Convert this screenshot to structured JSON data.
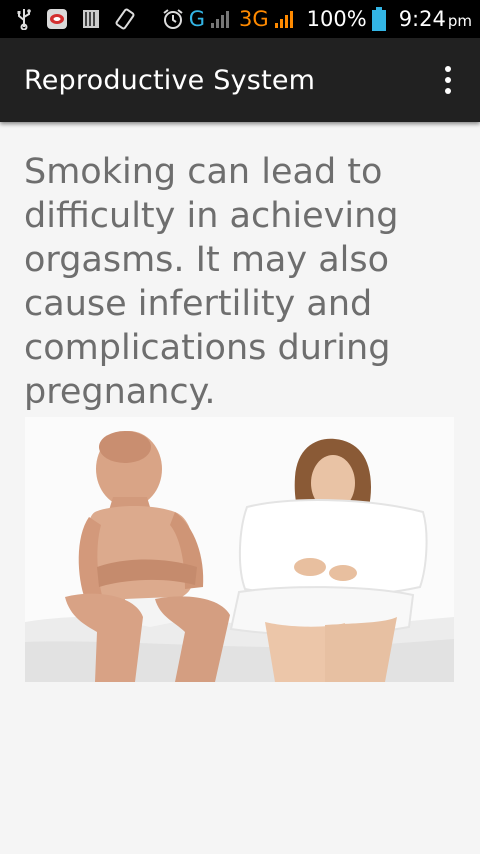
{
  "status_bar": {
    "icons": [
      "usb-icon",
      "notification-app-icon",
      "storage-icon",
      "rotate-icon",
      "alarm-icon"
    ],
    "network_g": "G",
    "network_3g": "3G",
    "battery_percent": "100%",
    "time": "9:24",
    "ampm": "pm",
    "colors": {
      "g_signal": "#33b5e5",
      "3g_signal": "#ff8a00",
      "battery": "#33b5e5"
    }
  },
  "app_bar": {
    "title": "Reproductive System",
    "background": "#212121"
  },
  "content": {
    "text": "Smoking can lead to difficulty in achieving orgasms. It may also cause infertility and complications during pregnancy."
  }
}
